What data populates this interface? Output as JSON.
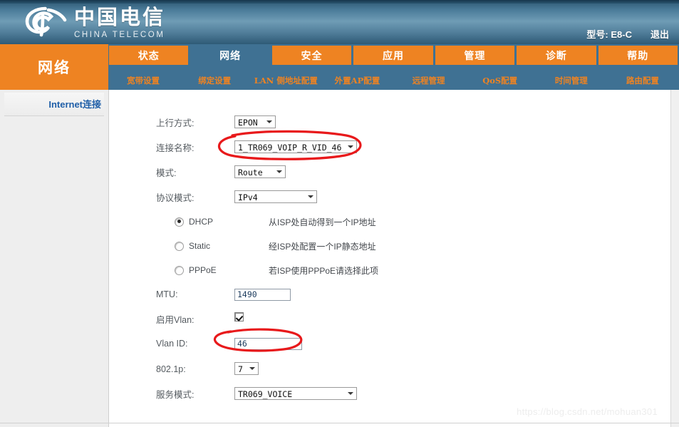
{
  "brand": {
    "cn_name": "中国电信",
    "en_name": "CHINA TELECOM",
    "logo_icon": "china-telecom-logo-icon"
  },
  "header": {
    "model_label": "型号: E8-C",
    "logout_label": "退出"
  },
  "side_title": "网络",
  "nav": {
    "tabs": [
      {
        "label": "状态",
        "active": false
      },
      {
        "label": "网络",
        "active": true
      },
      {
        "label": "安全",
        "active": false
      },
      {
        "label": "应用",
        "active": false
      },
      {
        "label": "管理",
        "active": false
      },
      {
        "label": "诊断",
        "active": false
      },
      {
        "label": "帮助",
        "active": false
      }
    ],
    "subtabs": [
      {
        "label": "宽带设置",
        "active": true
      },
      {
        "label": "绑定设置",
        "active": false
      },
      {
        "label": "LAN 侧地址配置",
        "active": false
      },
      {
        "label": "外置AP配置",
        "active": false
      },
      {
        "label": "远程管理",
        "active": false
      },
      {
        "label": "QoS配置",
        "active": false
      },
      {
        "label": "时间管理",
        "active": false
      },
      {
        "label": "路由配置",
        "active": false
      }
    ]
  },
  "sidebar": {
    "items": [
      {
        "label": "Internet连接"
      }
    ]
  },
  "form": {
    "uplink": {
      "label": "上行方式:",
      "value": "EPON"
    },
    "connection": {
      "label": "连接名称:",
      "value": "1_TR069_VOIP_R_VID_46"
    },
    "mode": {
      "label": "模式:",
      "value": "Route"
    },
    "protocol": {
      "label": "协议模式:",
      "value": "IPv4"
    },
    "ip_modes": [
      {
        "name": "DHCP",
        "desc": "从ISP处自动得到一个IP地址",
        "selected": true
      },
      {
        "name": "Static",
        "desc": "经ISP处配置一个IP静态地址",
        "selected": false
      },
      {
        "name": "PPPoE",
        "desc": "若ISP使用PPPoE请选择此项",
        "selected": false
      }
    ],
    "mtu": {
      "label": "MTU:",
      "value": "1490"
    },
    "enable_vlan": {
      "label": "启用Vlan:",
      "checked": true
    },
    "vlan_id": {
      "label": "Vlan ID:",
      "value": "46"
    },
    "dot1p": {
      "label": "802.1p:",
      "value": "7"
    },
    "service_mode": {
      "label": "服务模式:",
      "value": "TR069_VOICE"
    }
  },
  "watermark": "https://blog.csdn.net/mohuan301",
  "colors": {
    "orange": "#ee8322",
    "steel_blue": "#3f7193",
    "banner_blue": "#4a7b99",
    "sidebar_link": "#1f5fa8",
    "annotation_red": "#e8191b"
  }
}
